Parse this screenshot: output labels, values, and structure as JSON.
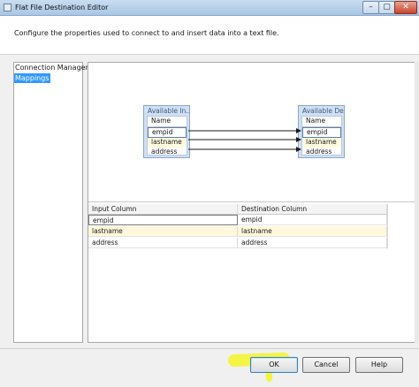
{
  "window": {
    "title": "Flat File Destination Editor",
    "controls": {
      "minimize": "–",
      "maximize": "▢",
      "close": "✕"
    }
  },
  "header": {
    "description": "Configure the properties used to connect to and insert data into a text file."
  },
  "nav": {
    "items": [
      {
        "label": "Connection Manager",
        "selected": false
      },
      {
        "label": "Mappings",
        "selected": true
      }
    ]
  },
  "diagram": {
    "input_box": {
      "title": "Available In...",
      "header": "Name",
      "columns": [
        "empid",
        "lastname",
        "address"
      ]
    },
    "output_box": {
      "title": "Available De...",
      "header": "Name",
      "columns": [
        "empid",
        "lastname",
        "address"
      ]
    }
  },
  "grid": {
    "headers": [
      "Input Column",
      "Destination Column"
    ],
    "rows": [
      [
        "empid",
        "empid"
      ],
      [
        "lastname",
        "lastname"
      ],
      [
        "address",
        "address"
      ]
    ]
  },
  "buttons": {
    "ok": "OK",
    "cancel": "Cancel",
    "help": "Help"
  },
  "colors": {
    "selection": "#3399ff",
    "highlighter": "#f5f528"
  }
}
